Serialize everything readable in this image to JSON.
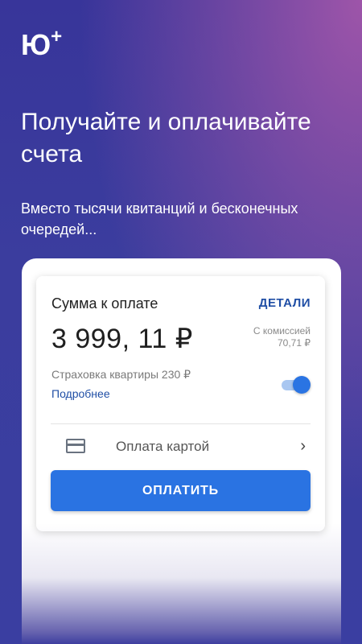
{
  "brand": {
    "logo_text": "Ю",
    "logo_plus": "+"
  },
  "headline": "Получайте и оплачивайте счета",
  "subtext": "Вместо тысячи квитанций и бесконечных очередей...",
  "card": {
    "title": "Сумма к оплате",
    "details_label": "ДЕТАЛИ",
    "amount": "3 999, 11 ₽",
    "commission_label": "С комиссией",
    "commission_value": "70,71 ₽",
    "insurance_text": "Страховка квартиры 230 ₽",
    "more_link": "Подробнее",
    "insurance_toggle_on": true,
    "payment_method_icon": "credit-card-icon",
    "payment_method_label": "Оплата картой",
    "pay_button_label": "ОПЛАТИТЬ"
  },
  "colors": {
    "accent": "#2a73e2",
    "link": "#1f4ea5",
    "background_start": "#38359a",
    "background_end": "#9e55a9"
  }
}
